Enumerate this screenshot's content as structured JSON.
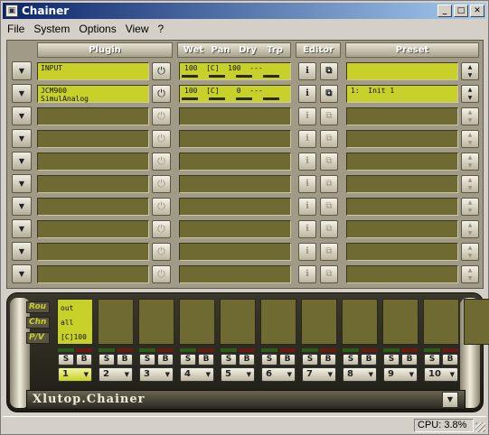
{
  "window": {
    "title": "Chainer",
    "min": "_",
    "max": "□",
    "close": "✕"
  },
  "menu": [
    {
      "label": "File"
    },
    {
      "label": "System"
    },
    {
      "label": "Options"
    },
    {
      "label": "View"
    },
    {
      "label": "?"
    }
  ],
  "headers": {
    "plugin": "Plugin",
    "wet": "Wet",
    "pan": "Pan",
    "dry": "Dry",
    "trp": "Trp",
    "editor": "Editor",
    "preset": "Preset"
  },
  "rows": [
    {
      "plugin": "INPUT",
      "mix": "100  [C]  100  ---",
      "preset": "",
      "active": true
    },
    {
      "plugin": "JCM900\nSimulAnalog",
      "mix": "100  [C]    0  ---",
      "preset": "1:  Init 1",
      "active": true
    },
    {
      "plugin": "",
      "mix": "",
      "preset": "",
      "active": false
    },
    {
      "plugin": "",
      "mix": "",
      "preset": "",
      "active": false
    },
    {
      "plugin": "",
      "mix": "",
      "preset": "",
      "active": false
    },
    {
      "plugin": "",
      "mix": "",
      "preset": "",
      "active": false
    },
    {
      "plugin": "",
      "mix": "",
      "preset": "",
      "active": false
    },
    {
      "plugin": "",
      "mix": "",
      "preset": "",
      "active": false
    },
    {
      "plugin": "",
      "mix": "",
      "preset": "",
      "active": false
    },
    {
      "plugin": "",
      "mix": "",
      "preset": "",
      "active": false
    }
  ],
  "rack": {
    "labels": {
      "rou": "Rou",
      "chn": "Chn",
      "pv": "P/V"
    },
    "summary": {
      "line1": "out",
      "line2": "all",
      "line3": "[C]100"
    },
    "btn_s": "S",
    "btn_b": "B",
    "slots": [
      "1",
      "2",
      "3",
      "4",
      "5",
      "6",
      "7",
      "8",
      "9",
      "10"
    ],
    "brand": "Xlutop.Chainer"
  },
  "status": {
    "cpu": "CPU: 3.8%"
  }
}
